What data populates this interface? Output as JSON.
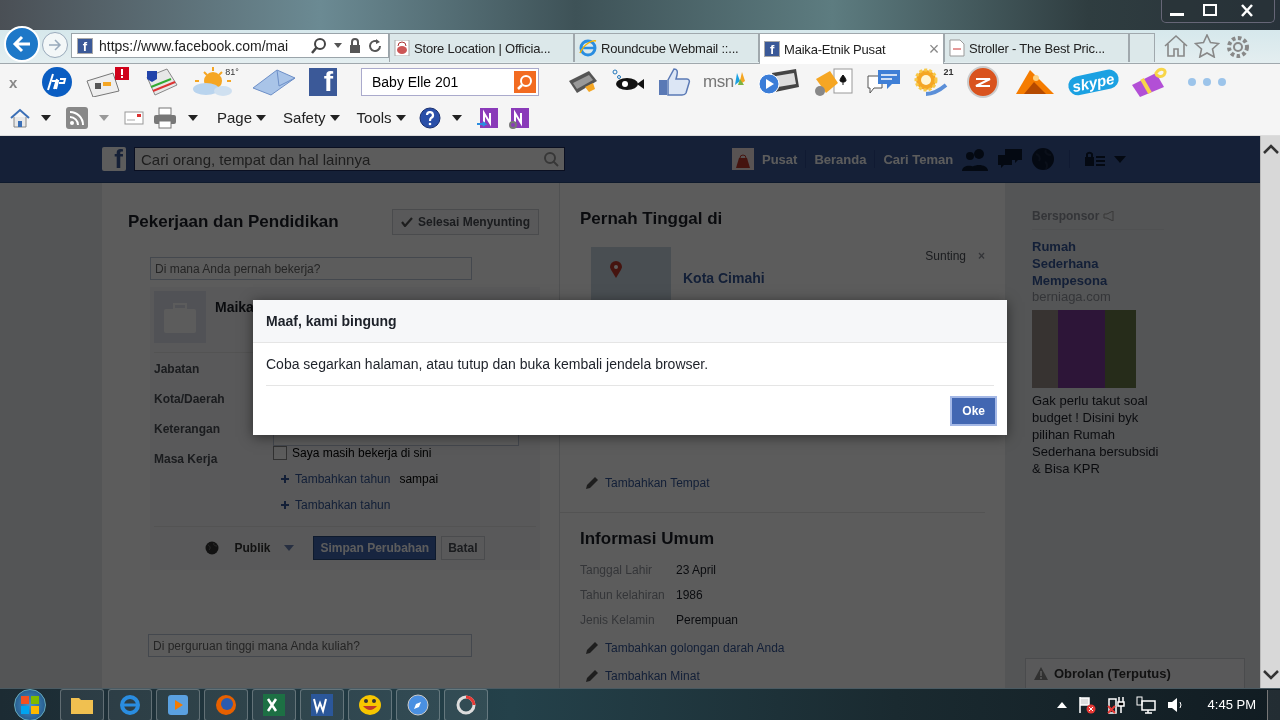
{
  "browser": {
    "address_icon": "f",
    "address": "https://www.facebook.com/mai",
    "tab_icon": "f",
    "toolbar_facebook": "f",
    "tabs": [
      {
        "label": "Store Location | Officia...",
        "selected": false
      },
      {
        "label": "Roundcube Webmail ::...",
        "selected": false
      },
      {
        "label": "Maika-Etnik Pusat",
        "selected": true
      },
      {
        "label": "Stroller - The Best Pric...",
        "selected": false
      }
    ],
    "tab_close": "×",
    "toolbar_close": "x",
    "weather_temp": "81°",
    "toolbar_search": {
      "value": "Baby Elle 201"
    },
    "msn_logo": "msn",
    "counter_badge": "21",
    "skype_logo": "skype",
    "command_bar": [
      "Page",
      "Safety",
      "Tools"
    ]
  },
  "facebook": {
    "logo": "f",
    "search": {
      "placeholder": "Cari orang, tempat dan hal lainnya"
    },
    "nav": [
      "Pusat",
      "Beranda",
      "Cari Teman"
    ]
  },
  "work_education": {
    "title": "Pekerjaan dan Pendidikan",
    "done_button": "Selesai Menyunting",
    "workplace_field": {
      "placeholder": "Di mana Anda pernah bekerja?"
    },
    "employer": "Maika",
    "labels": [
      "Jabatan",
      "Kota/Daerah",
      "Keterangan",
      "Masa Kerja"
    ],
    "still_working": {
      "label": "Saya masih bekerja di sini",
      "checked": false
    },
    "add_year": "Tambahkan tahun",
    "until": "sampai",
    "add_year_2": "Tambahkan tahun",
    "privacy": "Publik",
    "save_button": "Simpan Perubahan",
    "cancel_button": "Batal",
    "college_field": {
      "placeholder": "Di perguruan tinggi mana Anda kuliah?"
    }
  },
  "places": {
    "title": "Pernah Tinggal di",
    "place": "Kota Cimahi",
    "edit": "Sunting",
    "remove": "×",
    "add_place": "Tambahkan Tempat"
  },
  "general_info": {
    "title": "Informasi Umum",
    "rows": [
      {
        "label": "Tanggal Lahir",
        "value": "23 April"
      },
      {
        "label": "Tahun kelahiran",
        "value": "1986"
      },
      {
        "label": "Jenis Kelamin",
        "value": "Perempuan"
      }
    ],
    "links": [
      "Tambahkan golongan darah Anda",
      "Tambahkan Minat"
    ]
  },
  "sponsored": {
    "heading": "Bersponsor",
    "title": "Rumah Sederhana Mempesona",
    "domain": "berniaga.com",
    "text": "Gak perlu takut soal budget ! Disini byk pilihan Rumah Sederhana bersubsidi & Bisa KPR"
  },
  "chat": {
    "label": "Obrolan (Terputus)"
  },
  "dialog": {
    "title": "Maaf, kami bingung",
    "message": "Coba segarkan halaman, atau tutup dan buka kembali jendela browser.",
    "button": "Oke"
  },
  "taskbar": {
    "clock": "4:45 PM"
  }
}
